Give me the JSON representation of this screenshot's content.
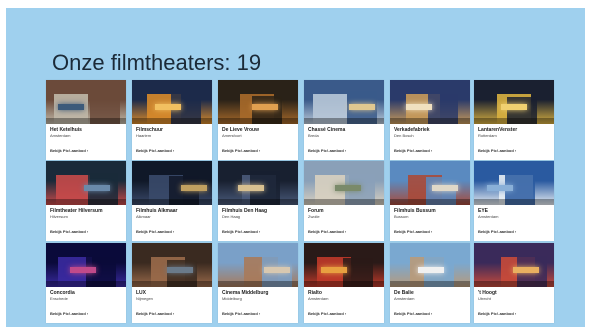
{
  "slide": {
    "title": "Onze filmtheaters: 19"
  },
  "theaters": [
    {
      "name": "Het Ketelhuis",
      "city": "Amsterdam",
      "link": "Bekijk Pic!-aanbod ›",
      "palette": [
        "#6b4a3a",
        "#c0b8a8",
        "#3c5a7a"
      ]
    },
    {
      "name": "Filmschuur",
      "city": "Haarlem",
      "link": "Bekijk Pic!-aanbod ›",
      "palette": [
        "#1c2a4a",
        "#d88a2a",
        "#f2c060"
      ]
    },
    {
      "name": "De Lieve Vrouw",
      "city": "Amersfoort",
      "link": "Bekijk Pic!-aanbod ›",
      "palette": [
        "#2a2218",
        "#a86a2a",
        "#e0a050"
      ]
    },
    {
      "name": "Chassé Cinema",
      "city": "Breda",
      "link": "Bekijk Pic!-aanbod ›",
      "palette": [
        "#3a5a8a",
        "#b8c8d8",
        "#e0c890"
      ]
    },
    {
      "name": "Verkadefabriek",
      "city": "Den Bosch",
      "link": "Bekijk Pic!-aanbod ›",
      "palette": [
        "#2a3a6a",
        "#c89a5a",
        "#f0e0c0"
      ]
    },
    {
      "name": "LantarenVenster",
      "city": "Rotterdam",
      "link": "Bekijk Pic!-aanbod ›",
      "palette": [
        "#1a2030",
        "#d8b040",
        "#f0d070"
      ]
    },
    {
      "name": "Filmtheater Hilversum",
      "city": "Hilversum",
      "link": "Bekijk Pic!-aanbod ›",
      "palette": [
        "#1a2a3a",
        "#c84a4a",
        "#6a8aaa"
      ]
    },
    {
      "name": "Filmhuis Alkmaar",
      "city": "Alkmaar",
      "link": "Bekijk Pic!-aanbod ›",
      "palette": [
        "#101828",
        "#3a4a6a",
        "#c0a060"
      ]
    },
    {
      "name": "Filmhuis Den Haag",
      "city": "Den Haag",
      "link": "Bekijk Pic!-aanbod ›",
      "palette": [
        "#182030",
        "#4a5a7a",
        "#d8c090"
      ]
    },
    {
      "name": "Forum",
      "city": "Zwolle",
      "link": "Bekijk Pic!-aanbod ›",
      "palette": [
        "#8aa0b8",
        "#d8d0c0",
        "#7a8a6a"
      ]
    },
    {
      "name": "Filmhuis Bussum",
      "city": "Bussum",
      "link": "Bekijk Pic!-aanbod ›",
      "palette": [
        "#5a8ac0",
        "#a84a3a",
        "#e0d8c8"
      ]
    },
    {
      "name": "EYE",
      "city": "Amsterdam",
      "link": "Bekijk Pic!-aanbod ›",
      "palette": [
        "#2a5aa0",
        "#e8eef4",
        "#8ab0d8"
      ]
    },
    {
      "name": "Concordia",
      "city": "Enschede",
      "link": "Bekijk Pic!-aanbod ›",
      "palette": [
        "#0a0a3a",
        "#3a2aa0",
        "#c04a8a"
      ]
    },
    {
      "name": "LUX",
      "city": "Nijmegen",
      "link": "Bekijk Pic!-aanbod ›",
      "palette": [
        "#3a2a20",
        "#9a6a4a",
        "#6a7a8a"
      ]
    },
    {
      "name": "Cinema Middelburg",
      "city": "Middelburg",
      "link": "Bekijk Pic!-aanbod ›",
      "palette": [
        "#7aa0c8",
        "#a87a5a",
        "#d8c8b0"
      ]
    },
    {
      "name": "Rialto",
      "city": "Amsterdam",
      "link": "Bekijk Pic!-aanbod ›",
      "palette": [
        "#2a1a18",
        "#c03a2a",
        "#e8a040"
      ]
    },
    {
      "name": "De Balie",
      "city": "Amsterdam",
      "link": "Bekijk Pic!-aanbod ›",
      "palette": [
        "#7aa8d0",
        "#b89a7a",
        "#f0f0f0"
      ]
    },
    {
      "name": "'t Hoogt",
      "city": "Utrecht",
      "link": "Bekijk Pic!-aanbod ›",
      "palette": [
        "#3a2a5a",
        "#c84a3a",
        "#e8b060"
      ]
    }
  ]
}
